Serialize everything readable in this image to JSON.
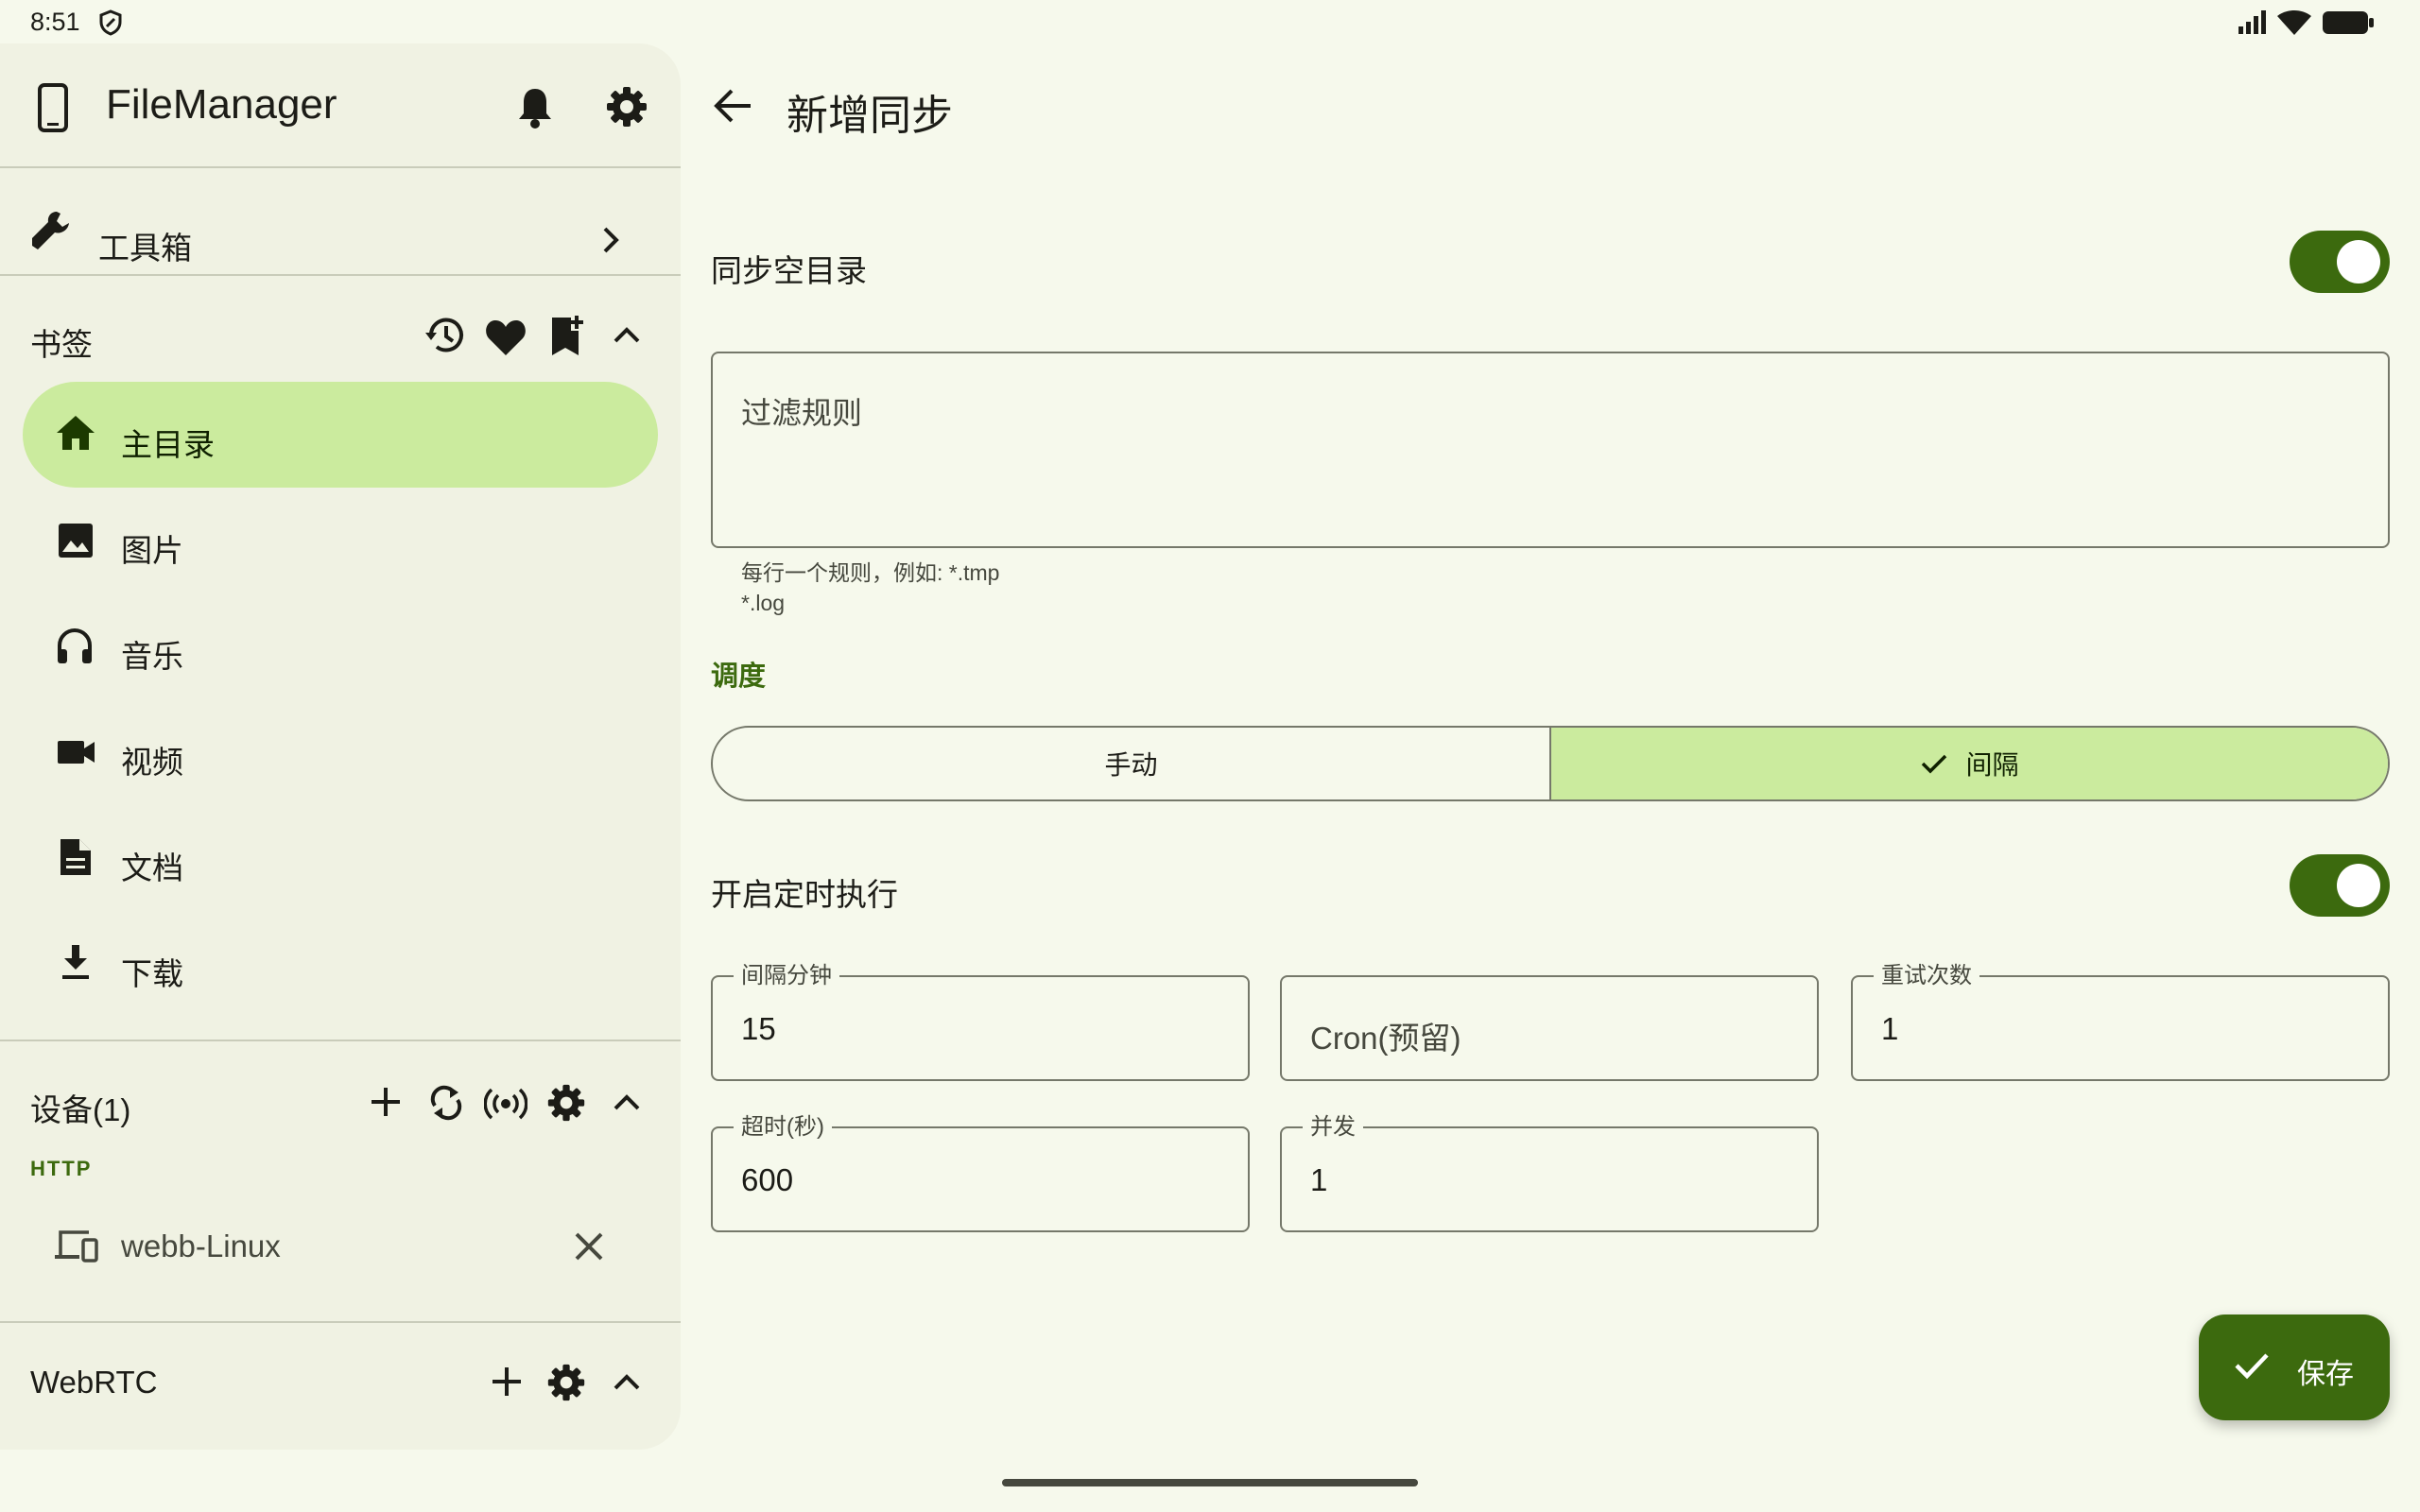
{
  "status_bar": {
    "time": "8:51"
  },
  "drawer": {
    "app_title": "FileManager",
    "toolbox_label": "工具箱",
    "bookmarks": {
      "title": "书签",
      "items": [
        {
          "label": "主目录",
          "icon": "home-icon",
          "active": true
        },
        {
          "label": "图片",
          "icon": "image-icon"
        },
        {
          "label": "音乐",
          "icon": "headphones-icon"
        },
        {
          "label": "视频",
          "icon": "videocam-icon"
        },
        {
          "label": "文档",
          "icon": "document-icon"
        },
        {
          "label": "下载",
          "icon": "download-icon"
        }
      ]
    },
    "devices": {
      "title": "设备(1)",
      "group_label": "HTTP",
      "device_name": "webb-Linux"
    },
    "webrtc": {
      "title": "WebRTC"
    }
  },
  "main": {
    "title": "新增同步",
    "sync_empty_dir": {
      "label": "同步空目录",
      "enabled": true
    },
    "filter": {
      "placeholder": "过滤规则",
      "helper_line1": "每行一个规则，例如: *.tmp",
      "helper_line2": "*.log"
    },
    "schedule": {
      "label": "调度",
      "options": [
        "手动",
        "间隔"
      ],
      "selected": "间隔"
    },
    "timed_exec": {
      "label": "开启定时执行",
      "enabled": true
    },
    "fields": {
      "interval": {
        "label": "间隔分钟",
        "value": "15"
      },
      "cron": {
        "value": "Cron(预留)"
      },
      "retries": {
        "label": "重试次数",
        "value": "1"
      },
      "timeout": {
        "label": "超时(秒)",
        "value": "600"
      },
      "concurrency": {
        "label": "并发",
        "value": "1"
      }
    },
    "save_label": "保存"
  },
  "colors": {
    "accent": "#3c6a0e",
    "accent_container": "#cbeb9e",
    "background": "#f6f9ec",
    "drawer": "#f0f2e3"
  }
}
